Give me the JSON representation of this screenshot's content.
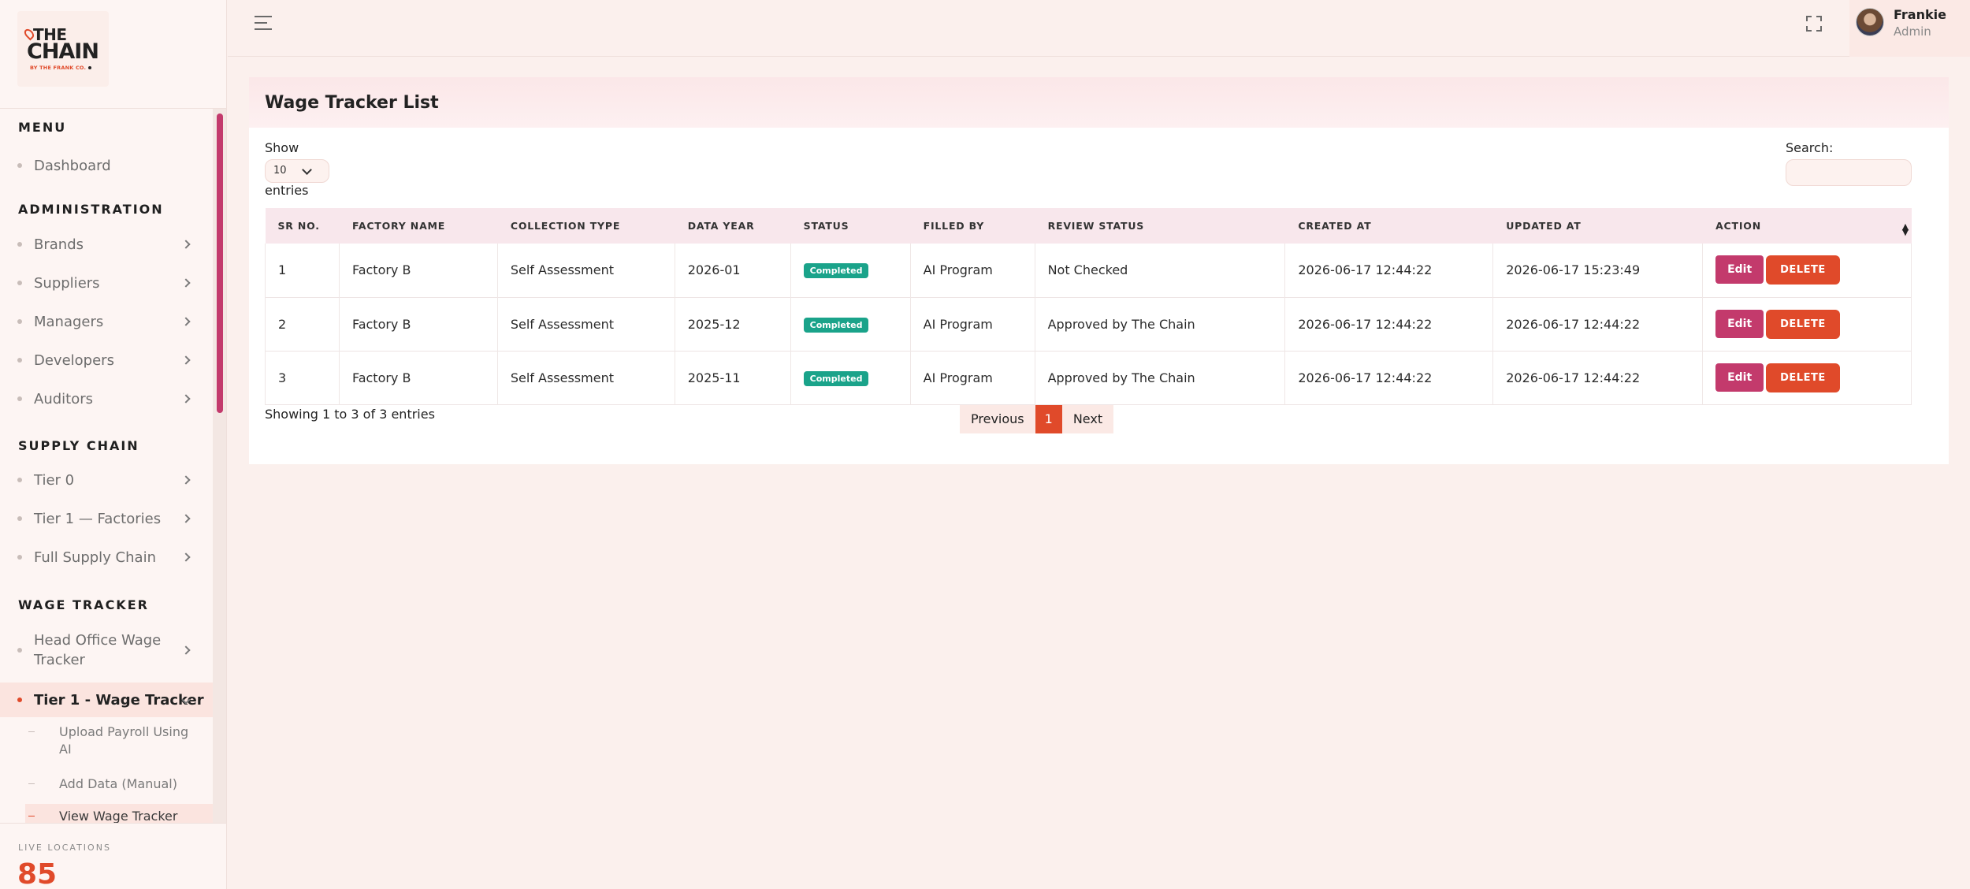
{
  "brand": {
    "line1": "THE",
    "line2": "CHAIN",
    "tagline": "BY THE FRANK CO."
  },
  "sidebar": {
    "sections": [
      {
        "title": "MENU"
      },
      {
        "title": "ADMINISTRATION"
      },
      {
        "title": "SUPPLY CHAIN"
      },
      {
        "title": "WAGE TRACKER"
      }
    ],
    "items": {
      "dashboard": "Dashboard",
      "brands": "Brands",
      "suppliers": "Suppliers",
      "managers": "Managers",
      "developers": "Developers",
      "auditors": "Auditors",
      "tier0": "Tier 0",
      "tier1_factories": "Tier 1 — Factories",
      "full_supply_chain": "Full Supply Chain",
      "head_office_wage_tracker": "Head Office Wage Tracker",
      "tier1_wage_tracker": "Tier 1 - Wage Tracker"
    },
    "subitems": {
      "upload_payroll": "Upload Payroll Using AI",
      "add_data_manual": "Add Data (Manual)",
      "view_wage_tracker": "View Wage Tracker"
    },
    "live_locations": {
      "label": "LIVE LOCATIONS",
      "count": "85"
    }
  },
  "topbar": {
    "user": {
      "name": "Frankie",
      "role": "Admin"
    }
  },
  "page": {
    "title": "Wage Tracker List",
    "show_label": "Show",
    "entries_value": "10",
    "entries_label": "entries",
    "search_label": "Search:",
    "search_value": "",
    "info": "Showing 1 to 3 of 3 entries",
    "pagination": {
      "previous": "Previous",
      "current": "1",
      "next": "Next"
    }
  },
  "table": {
    "headers": {
      "sr_no": "SR NO.",
      "factory_name": "FACTORY NAME",
      "collection_type": "COLLECTION TYPE",
      "data_year": "DATA YEAR",
      "status": "STATUS",
      "filled_by": "FILLED BY",
      "review_status": "REVIEW STATUS",
      "created_at": "CREATED AT",
      "updated_at": "UPDATED AT",
      "action": "ACTION"
    },
    "rows": [
      {
        "sr": "1",
        "factory": "Factory B",
        "collection": "Self Assessment",
        "year": "2026-01",
        "status": "Completed",
        "filled_by": "AI Program",
        "review": "Not Checked",
        "created": "2026-06-17 12:44:22",
        "updated": "2026-06-17 15:23:49",
        "edit": "Edit",
        "delete": "DELETE"
      },
      {
        "sr": "2",
        "factory": "Factory B",
        "collection": "Self Assessment",
        "year": "2025-12",
        "status": "Completed",
        "filled_by": "AI Program",
        "review": "Approved by The Chain",
        "created": "2026-06-17 12:44:22",
        "updated": "2026-06-17 12:44:22",
        "edit": "Edit",
        "delete": "DELETE"
      },
      {
        "sr": "3",
        "factory": "Factory B",
        "collection": "Self Assessment",
        "year": "2025-11",
        "status": "Completed",
        "filled_by": "AI Program",
        "review": "Approved by The Chain",
        "created": "2026-06-17 12:44:22",
        "updated": "2026-06-17 12:44:22",
        "edit": "Edit",
        "delete": "DELETE"
      }
    ]
  },
  "colors": {
    "accent_orange": "#e04a2a",
    "accent_magenta": "#c33a6c",
    "status_green": "#1aa38a"
  }
}
